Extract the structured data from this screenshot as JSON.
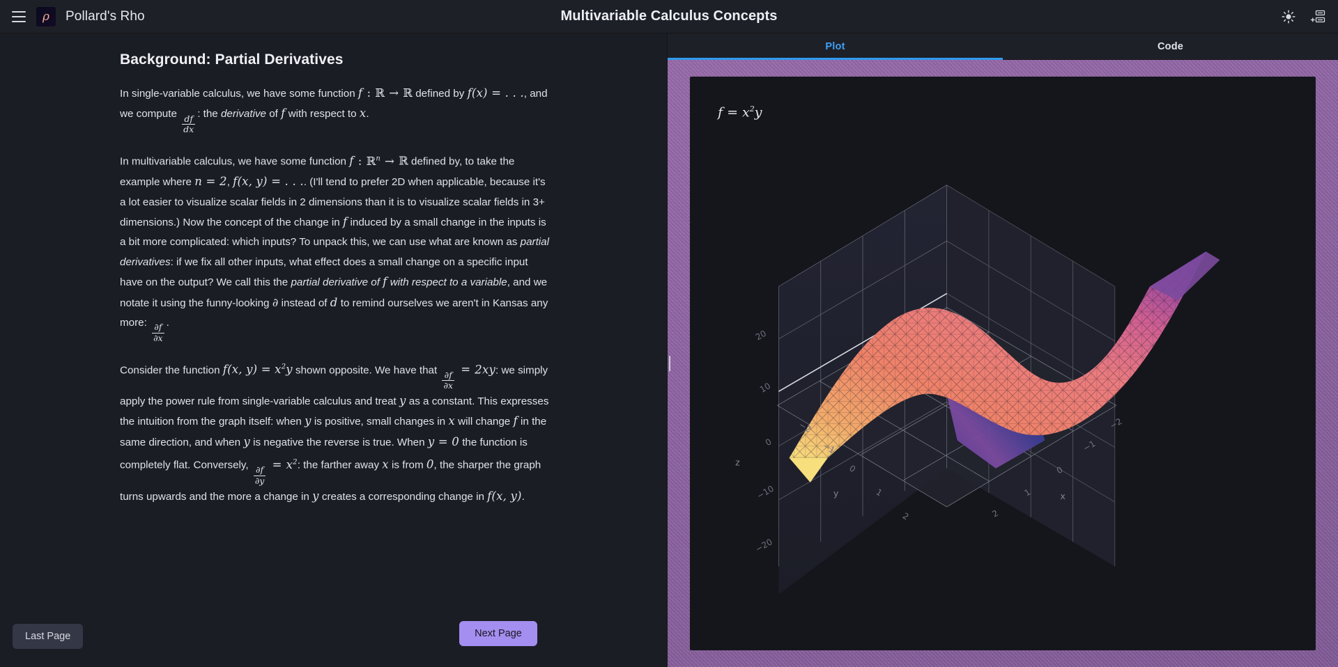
{
  "topbar": {
    "menu_icon": "hamburger-icon",
    "logo_glyph": "ρ",
    "app_name": "Pollard's Rho",
    "title": "Multivariable Calculus Concepts",
    "right_icons": [
      {
        "name": "brightness-icon",
        "label": "sun"
      },
      {
        "name": "add-panel-icon",
        "label": "new-panel"
      }
    ]
  },
  "document": {
    "title": "Background: Partial Derivatives",
    "paragraphs": [
      "In single-variable calculus, we have some function f : ℝ → ℝ defined by f(x) = ..., and we compute df/dx: the derivative of f with respect to x.",
      "In multivariable calculus, we have some function f : ℝⁿ → ℝ defined by, to take the example where n = 2, f(x, y) = .... (I'll tend to prefer 2D when applicable, because it's a lot easier to visualize scalar fields in 2 dimensions than it is to visualize scalar fields in 3+ dimensions.) Now the concept of the change in f induced by a small change in the inputs is a bit more complicated: which inputs? To unpack this, we can use what are known as partial derivatives: if we fix all other inputs, what effect does a small change on a specific input have on the output? We call this the partial derivative of f with respect to a variable, and we notate it using the funny-looking ∂ instead of d to remind ourselves we aren't in Kansas any more: ∂f/∂x.",
      "Consider the function f(x, y) = x²y shown opposite. We have that ∂f/∂x = 2xy: we simply apply the power rule from single-variable calculus and treat y as a constant. This expresses the intuition from the graph itself: when y is positive, small changes in x will change f in the same direction, and when y is negative the reverse is true. When y = 0 the function is completely flat. Conversely, ∂f/∂y = x²: the farther away x is from 0, the sharper the graph turns upwards and the more a change in y creates a corresponding change in f(x, y)."
    ],
    "fragments": {
      "p1_a": "In single-variable calculus, we have some function",
      "p1_b": "defined by",
      "p1_c": ", and we compute",
      "p1_d": ": the",
      "p1_e": "derivative",
      "p1_f": "of",
      "p1_g": "with respect to",
      "p2_a": "In multivariable calculus, we have some function",
      "p2_b": "defined by, to take the example where",
      "p2_c": ". (I'll tend to prefer 2D when applicable, because it's a lot easier to visualize scalar fields in 2 dimensions than it is to visualize scalar fields in 3+ dimensions.) Now the concept of the change in",
      "p2_d": "induced by a small change in the inputs is a bit more complicated: which inputs? To unpack this, we can use what are known as",
      "p2_e": "partial derivatives",
      "p2_f": ": if we fix all other inputs, what effect does a small change on a specific input have on the output? We call this the",
      "p2_g": "partial derivative of",
      "p2_h": "with respect to a variable",
      "p2_i": ", and we notate it using the funny-looking",
      "p2_j": "instead of",
      "p2_k": "to remind ourselves we aren't in Kansas any more:",
      "p3_a": "Consider the function",
      "p3_b": "shown opposite. We have that",
      "p3_c": ": we simply apply the power rule from single-variable calculus and treat",
      "p3_d": "as a constant. This expresses the intuition from the graph itself: when",
      "p3_e": "is positive, small changes in",
      "p3_f": "will change",
      "p3_g": "in the same direction, and when",
      "p3_h": "is negative the reverse is true. When",
      "p3_i": "the function is completely flat. Conversely,",
      "p3_j": ": the farther away",
      "p3_k": "is from",
      "p3_l": ", the sharper the graph turns upwards and the more a change in",
      "p3_m": "creates a corresponding change in",
      "p3_n": "."
    }
  },
  "footer": {
    "last_page_label": "Last Page",
    "next_page_label": "Next Page",
    "next_page_color": "#a48ef0"
  },
  "panel": {
    "tabs": [
      {
        "label": "Plot",
        "active": true
      },
      {
        "label": "Code",
        "active": false
      }
    ],
    "active_tab_color": "#3fa0f5",
    "background_color": "#8a5e96"
  },
  "chart_data": {
    "type": "surface",
    "title": "f = x²y",
    "equation": "f = x^2 y",
    "xlabel": "x",
    "ylabel": "y",
    "zlabel": "z",
    "xticks": [
      -2,
      -1,
      0,
      1,
      2
    ],
    "yticks": [
      -2,
      -1,
      0,
      1,
      2
    ],
    "zticks": [
      -20,
      -10,
      0,
      10,
      20
    ],
    "xlim": [
      -2,
      2
    ],
    "ylim": [
      -2,
      2
    ],
    "zlim": [
      -20,
      20
    ],
    "grid": true,
    "legend": "none",
    "colormap": "magma",
    "colormap_stops": [
      "#f5e07a",
      "#f0a868",
      "#ee8169",
      "#d9628c",
      "#a04a9c",
      "#5b3f9e",
      "#3a3a8c"
    ],
    "background_color": "#15161c",
    "description": "3D surface plot of f(x,y) = x^2 * y rendered as a triangulated mesh saddle-like surface; high ridge toward +x/+y, dip toward -y."
  }
}
